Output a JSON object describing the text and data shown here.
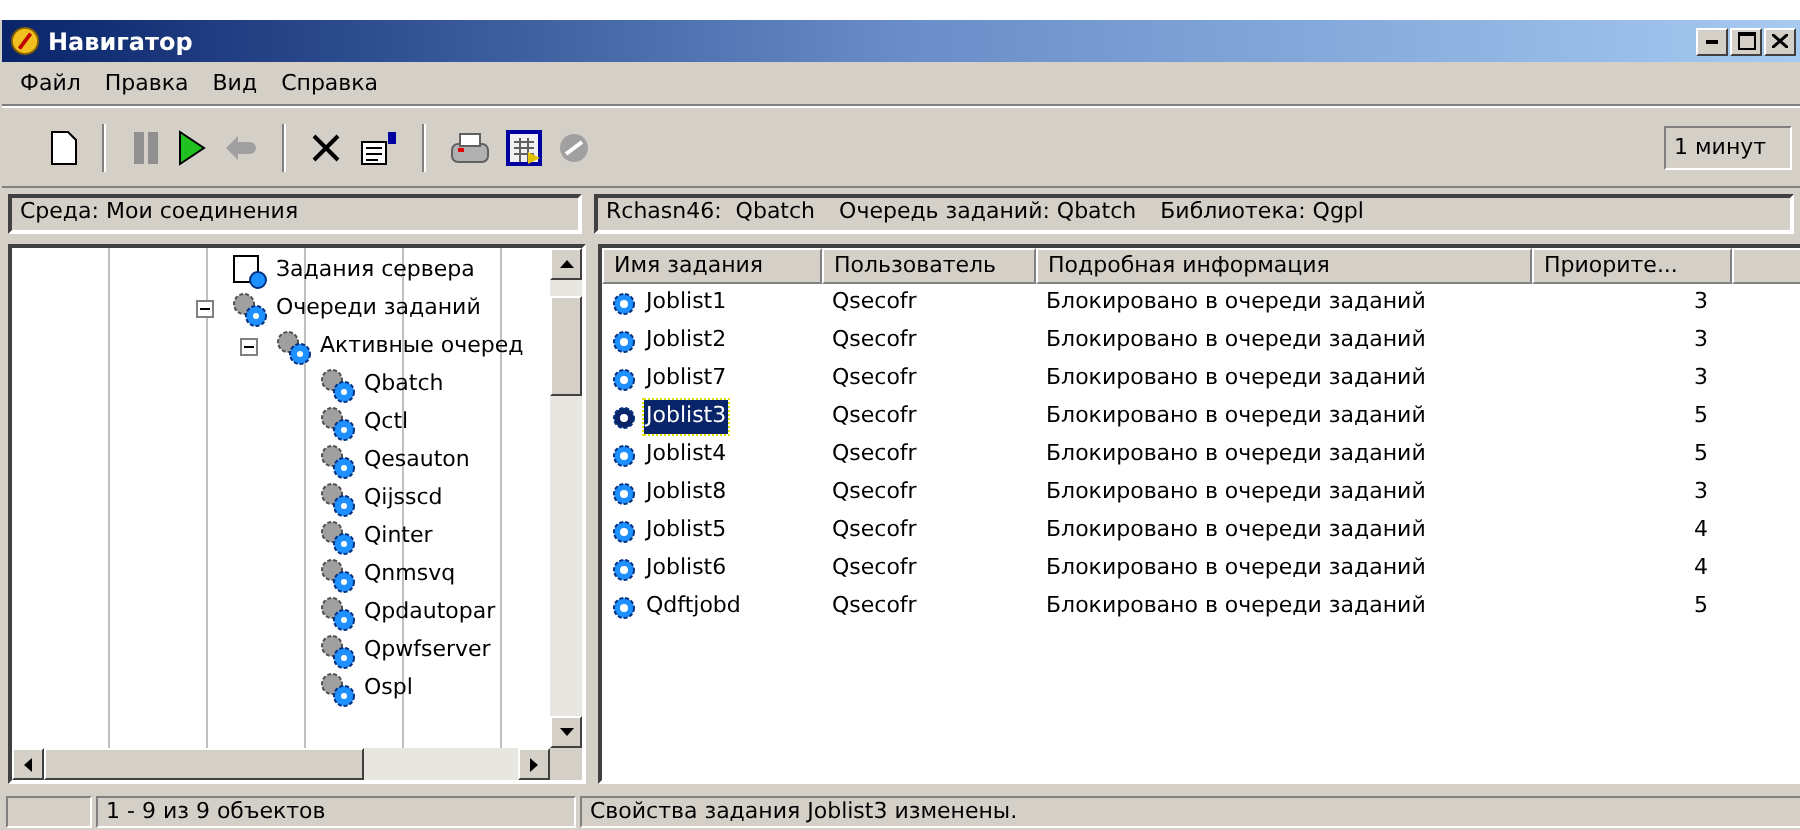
{
  "window": {
    "title": "Навигатор"
  },
  "menu": [
    "Файл",
    "Правка",
    "Вид",
    "Справка"
  ],
  "toolbar": [
    {
      "kind": "new",
      "disabled": false
    },
    {
      "kind": "sep"
    },
    {
      "kind": "hold",
      "disabled": false
    },
    {
      "kind": "release",
      "disabled": false
    },
    {
      "kind": "reply",
      "disabled": true
    },
    {
      "kind": "sep"
    },
    {
      "kind": "delete",
      "disabled": false
    },
    {
      "kind": "properties",
      "disabled": false
    },
    {
      "kind": "sep"
    },
    {
      "kind": "printer",
      "disabled": false
    },
    {
      "kind": "schedule",
      "disabled": false
    },
    {
      "kind": "stop",
      "disabled": true
    }
  ],
  "refresh_field": {
    "value": "1 минут"
  },
  "left_header": "Среда: Мои соединения",
  "right_header": [
    "Rchasn46:  Qbatch",
    "Очередь заданий: Qbatch",
    "Библиотека: Qgpl"
  ],
  "tree": [
    {
      "label": "Задания сервера",
      "kind": "server"
    },
    {
      "label": "Очереди заданий",
      "kind": "queues",
      "expanded": true,
      "children": [
        {
          "label": "Активные очеред",
          "kind": "active",
          "expanded": true,
          "children": [
            {
              "label": "Qbatch",
              "kind": "queue"
            },
            {
              "label": "Qctl",
              "kind": "queue"
            },
            {
              "label": "Qesauton",
              "kind": "queue"
            },
            {
              "label": "Qijsscd",
              "kind": "queue"
            },
            {
              "label": "Qinter",
              "kind": "queue"
            },
            {
              "label": "Qnmsvq",
              "kind": "queue"
            },
            {
              "label": "Qpdautopar",
              "kind": "queue"
            },
            {
              "label": "Qpwfserver",
              "kind": "queue"
            },
            {
              "label": "Ospl",
              "kind": "queue"
            }
          ]
        }
      ]
    }
  ],
  "table": {
    "columns": [
      "Имя задания",
      "Пользователь",
      "Подробная информация",
      "Приорите..."
    ],
    "rows": [
      {
        "cells": [
          "Joblist1",
          "Qsecofr",
          "Блокировано в очереди заданий",
          "3"
        ],
        "selected": false
      },
      {
        "cells": [
          "Joblist2",
          "Qsecofr",
          "Блокировано в очереди заданий",
          "3"
        ],
        "selected": false
      },
      {
        "cells": [
          "Joblist7",
          "Qsecofr",
          "Блокировано в очереди заданий",
          "3"
        ],
        "selected": false
      },
      {
        "cells": [
          "Joblist3",
          "Qsecofr",
          "Блокировано в очереди заданий",
          "5"
        ],
        "selected": true
      },
      {
        "cells": [
          "Joblist4",
          "Qsecofr",
          "Блокировано в очереди заданий",
          "5"
        ],
        "selected": false
      },
      {
        "cells": [
          "Joblist8",
          "Qsecofr",
          "Блокировано в очереди заданий",
          "3"
        ],
        "selected": false
      },
      {
        "cells": [
          "Joblist5",
          "Qsecofr",
          "Блокировано в очереди заданий",
          "4"
        ],
        "selected": false
      },
      {
        "cells": [
          "Joblist6",
          "Qsecofr",
          "Блокировано в очереди заданий",
          "4"
        ],
        "selected": false
      },
      {
        "cells": [
          "Qdftjobd",
          "Qsecofr",
          "Блокировано в очереди заданий",
          "5"
        ],
        "selected": false
      }
    ]
  },
  "status_bar": [
    "1 - 9 из 9 объектов",
    "Свойства задания Joblist3 изменены."
  ]
}
